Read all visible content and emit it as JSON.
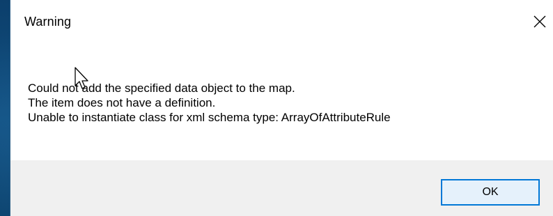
{
  "dialog": {
    "title": "Warning",
    "close_icon": "close-icon",
    "message_lines": [
      "Could not add the specified data object to the map.",
      "The item does not have a definition.",
      "Unable to instantiate class for xml schema type: ArrayOfAttributeRule"
    ],
    "ok_label": "OK"
  },
  "colors": {
    "accent": "#0078d7",
    "footer_bg": "#f0f0f0",
    "desktop_bg": "#0f4a7a"
  },
  "icons": {
    "cursor": "mouse-pointer-icon"
  }
}
